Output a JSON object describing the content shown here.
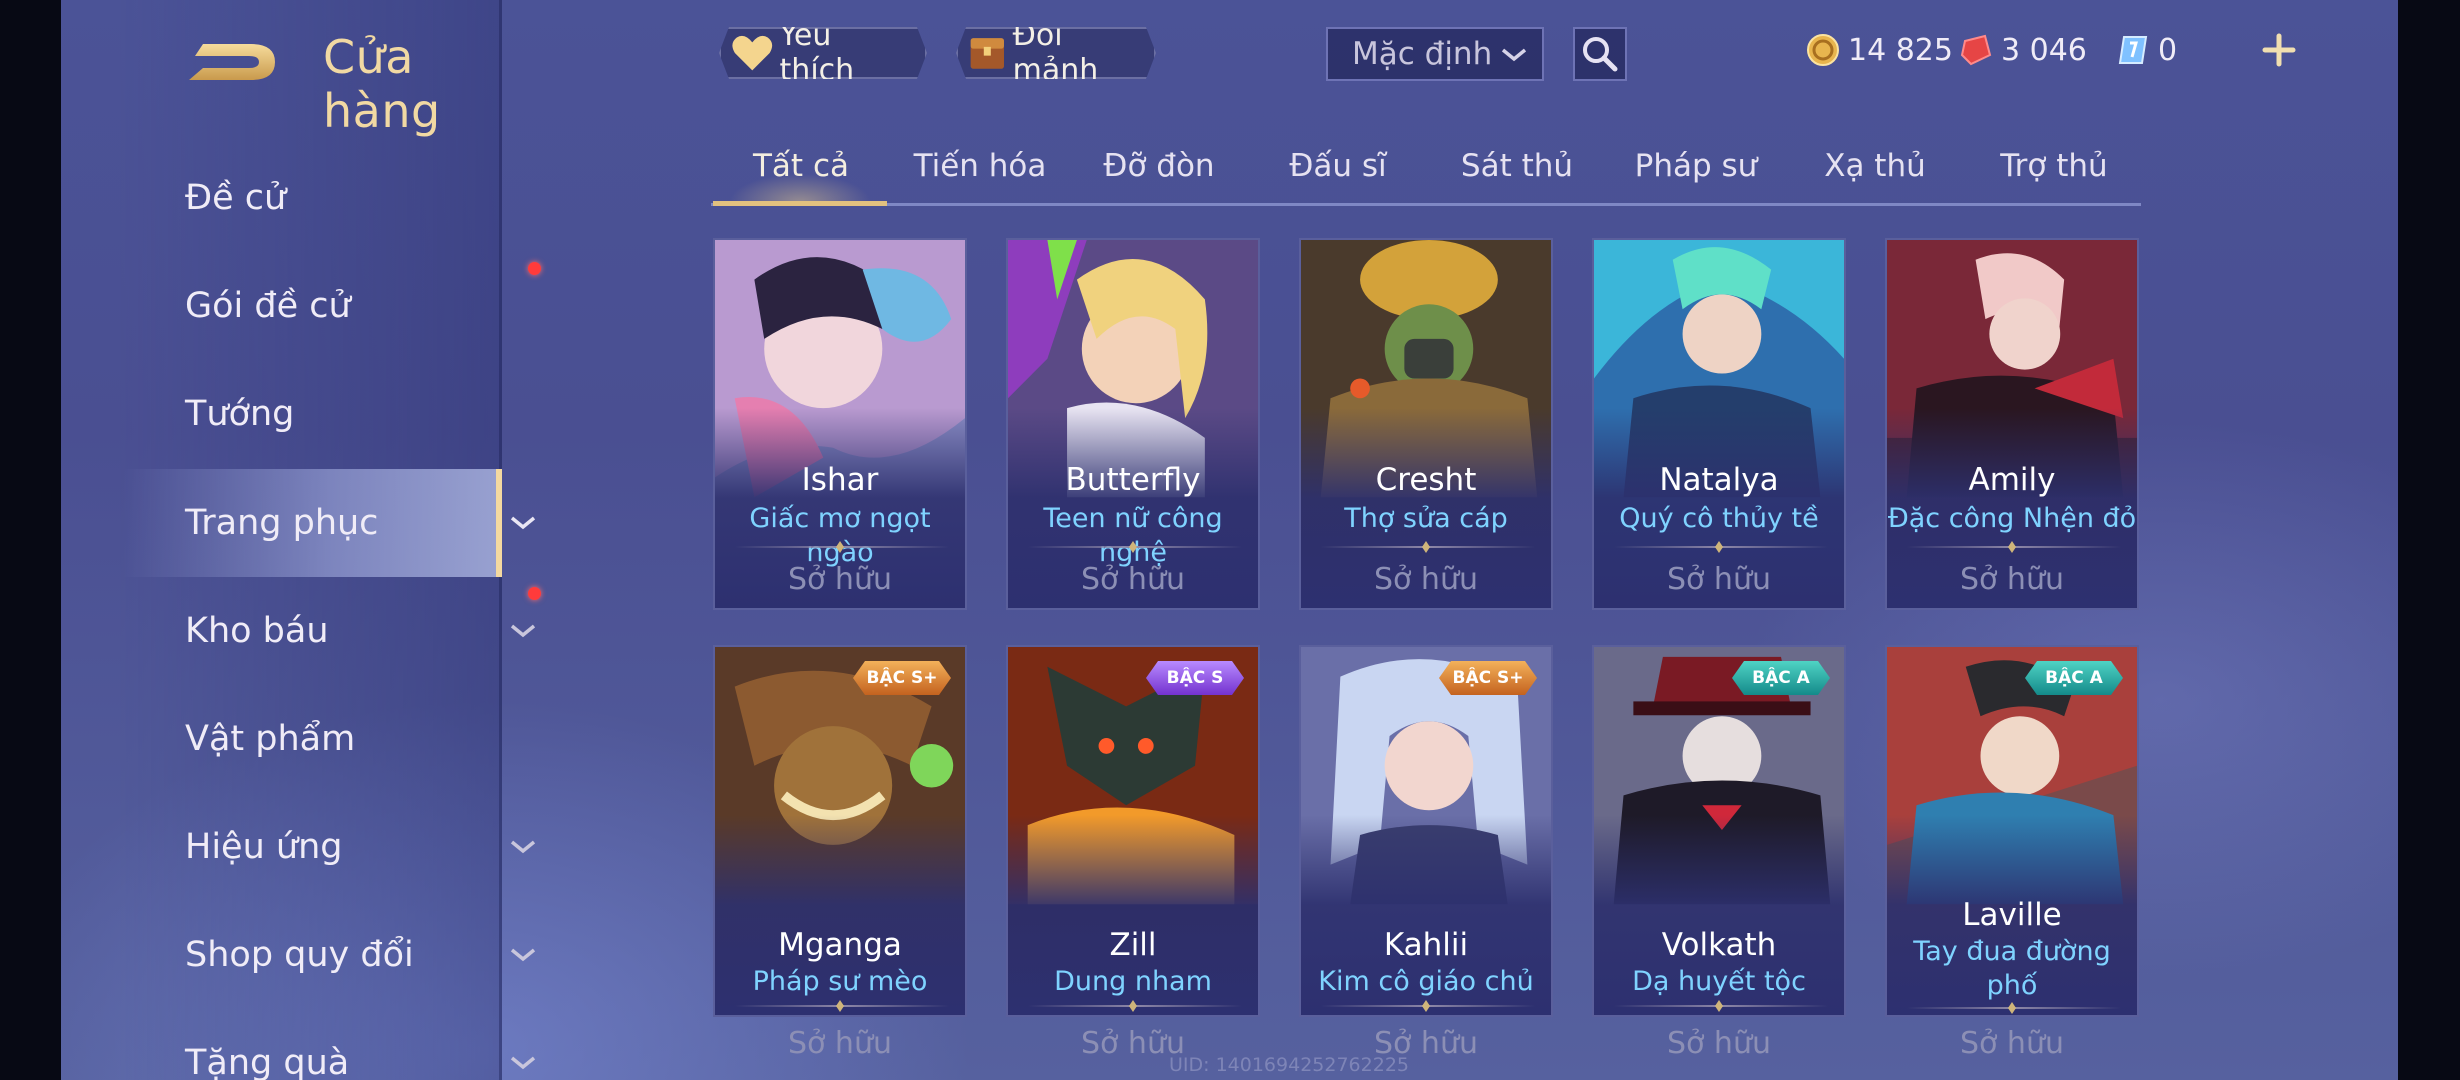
{
  "header": {
    "title": "Cửa hàng",
    "favorite_label": "Yêu thích",
    "exchange_label": "Đổi mảnh",
    "sort_value": "Mặc định",
    "gold": "14 825",
    "vouchers": "3 046",
    "tokens": "0"
  },
  "sidebar": {
    "items": [
      {
        "label": "Đề cử"
      },
      {
        "label": "Gói đề cử"
      },
      {
        "label": "Tướng"
      },
      {
        "label": "Trang phục"
      },
      {
        "label": "Kho báu"
      },
      {
        "label": "Vật phẩm"
      },
      {
        "label": "Hiệu ứng"
      },
      {
        "label": "Shop quy đổi"
      },
      {
        "label": "Tặng quà"
      }
    ]
  },
  "tabs": [
    "Tất cả",
    "Tiến hóa",
    "Đỡ đòn",
    "Đấu sĩ",
    "Sát thủ",
    "Pháp sư",
    "Xạ thủ",
    "Trợ thủ"
  ],
  "cards": [
    {
      "hero": "Ishar",
      "skin": "Giấc mơ ngọt ngào",
      "status": "Sở hữu"
    },
    {
      "hero": "Butterfly",
      "skin": "Teen nữ công nghệ",
      "status": "Sở hữu"
    },
    {
      "hero": "Cresht",
      "skin": "Thợ sửa cáp",
      "status": "Sở hữu"
    },
    {
      "hero": "Natalya",
      "skin": "Quý cô thủy tề",
      "status": "Sở hữu"
    },
    {
      "hero": "Amily",
      "skin": "Đặc công Nhện đỏ",
      "status": "Sở hữu"
    },
    {
      "hero": "Mganga",
      "skin": "Pháp sư mèo",
      "status": "Sở hữu",
      "badge": "BẬC S+"
    },
    {
      "hero": "Zill",
      "skin": "Dung nham",
      "status": "Sở hữu",
      "badge": "BẬC S"
    },
    {
      "hero": "Kahlii",
      "skin": "Kim cô giáo chủ",
      "status": "Sở hữu",
      "badge": "BẬC S+"
    },
    {
      "hero": "Volkath",
      "skin": "Dạ huyết tộc",
      "status": "Sở hữu",
      "badge": "BẬC A"
    },
    {
      "hero": "Laville",
      "skin_line1": "Tay đua đường",
      "skin_line2": "phố",
      "status": "Sở hữu",
      "badge": "BẬC A"
    }
  ],
  "uid": "UID: 1401694252762225",
  "colors": {
    "accent_gold": "#e2c17f",
    "skin_name": "#7fd3ff",
    "badge_red_dot": "#ff3b3b"
  }
}
